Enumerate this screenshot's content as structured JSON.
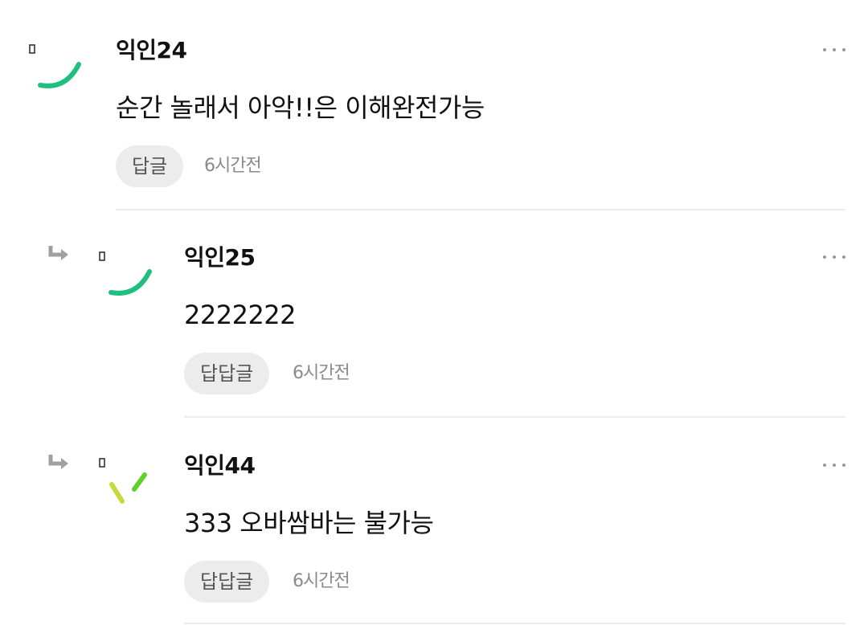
{
  "comments": [
    {
      "author": "익인24",
      "text": "순간 놀래서 아악!!은 이해완전가능",
      "reply_label": "답글",
      "time": "6시간전",
      "avatar_color": "#1fbf7f",
      "avatar_icon": "green-arc"
    },
    {
      "author": "익인25",
      "text": "2222222",
      "reply_label": "답답글",
      "time": "6시간전",
      "avatar_color": "#1fbf7f",
      "avatar_icon": "green-arc"
    },
    {
      "author": "익인44",
      "text": "333 오바쌈바는 불가능",
      "reply_label": "답답글",
      "time": "6시간전",
      "avatar_colors": [
        "#c9d93a",
        "#5fd12a"
      ],
      "avatar_icon": "two-strokes"
    }
  ],
  "icons": {
    "more": "more-horizontal-icon",
    "reply": "reply-arrow-icon"
  },
  "colors": {
    "reply_button_bg": "#ececec",
    "divider": "#ececec",
    "meta_text": "#8a8a8a"
  }
}
